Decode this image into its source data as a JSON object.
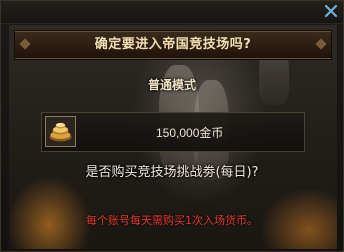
{
  "dialog": {
    "close_icon": "close-x-icon",
    "header_title": "确定要进入帝国竞技场吗?",
    "mode_label": "普通模式",
    "cost": {
      "item_icon": "gold-coin-pile-icon",
      "value": "150,000金币"
    },
    "question": "是否购买竞技场挑战劵(每日)?",
    "notice": "每个账号每天需购买1次入场货币。"
  },
  "colors": {
    "title_text": "#f2dfb4",
    "notice_text": "#e23a2a",
    "close_icon": "#6fb0d8"
  }
}
